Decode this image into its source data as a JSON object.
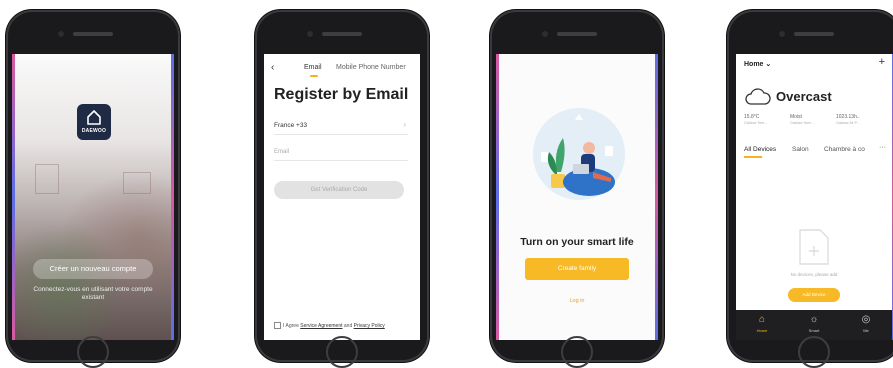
{
  "screen1": {
    "brand": "DAEWOO",
    "create_account": "Créer un nouveau compte",
    "login_hint": "Connectez-vous en utilisant votre compte existant"
  },
  "screen2": {
    "tab_email": "Email",
    "tab_phone": "Mobile Phone Number",
    "title": "Register by Email",
    "country": "France +33",
    "email_placeholder": "Email",
    "verify_button": "Get Verification Code",
    "agree_prefix": "I Agree",
    "service_agreement": "Service Agreement",
    "and": "and",
    "privacy_policy": "Privacy Policy"
  },
  "screen3": {
    "title": "Turn on your smart life",
    "create_family": "Create family",
    "login": "Log in"
  },
  "screen4": {
    "home": "Home",
    "weather": "Overcast",
    "stats": [
      {
        "value": "15.8°C",
        "label": "Outdoor Tem..."
      },
      {
        "value": "Moist",
        "label": "Outdoor Hum..."
      },
      {
        "value": "1023.13h..",
        "label": "Outdoor Air P..."
      }
    ],
    "tabs": [
      "All Devices",
      "Salon",
      "Chambre à co"
    ],
    "more": "···",
    "empty_text": "No devices, please add",
    "add_device": "Add Device",
    "nav": [
      {
        "label": "Home",
        "icon": "home-icon"
      },
      {
        "label": "Smart",
        "icon": "smart-icon"
      },
      {
        "label": "Me",
        "icon": "me-icon"
      }
    ]
  },
  "colors": {
    "accent": "#f7b925",
    "navy": "#1f2a44"
  }
}
